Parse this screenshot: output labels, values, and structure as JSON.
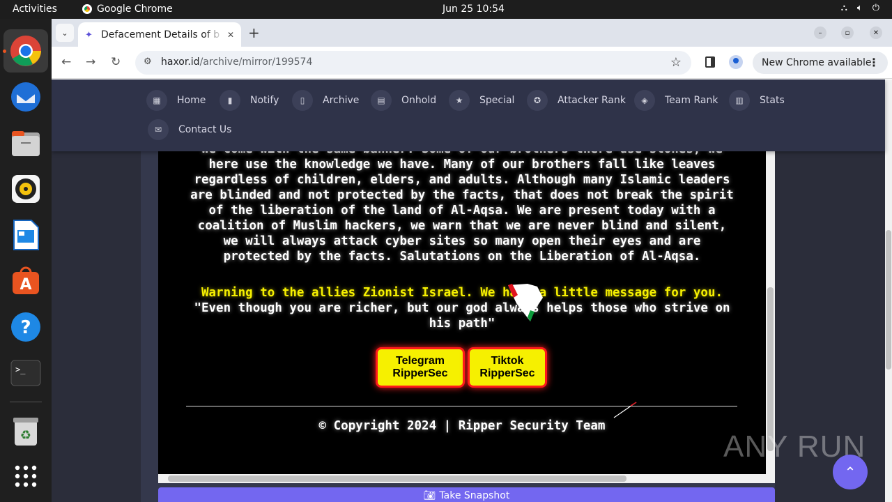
{
  "topbar": {
    "activities": "Activities",
    "app_name": "Google Chrome",
    "clock": "Jun 25  10:54"
  },
  "dock": {
    "items": [
      "chrome-icon",
      "thunderbird-icon",
      "files-icon",
      "rhythmbox-icon",
      "writer-icon",
      "app-center-icon",
      "help-icon",
      "terminal-icon",
      "trash-icon",
      "app-grid-icon"
    ]
  },
  "browser": {
    "tab_title": "Defacement Details of b",
    "url_host": "haxor.id",
    "url_path": "/archive/mirror/199574",
    "update_label": "New Chrome available"
  },
  "site_nav": {
    "items": [
      "Home",
      "Notify",
      "Archive",
      "Onhold",
      "Special",
      "Attacker Rank",
      "Team Rank",
      "Stats",
      "Contact Us"
    ]
  },
  "mirror": {
    "lines": [
      "we come with the same banner. Some of our brothers there use stones, we",
      "here use the knowledge we have. Many of our brothers fall like leaves",
      "regardless of children, elders, and adults. Although many Islamic leaders",
      "are blinded and not protected by the facts, that does not break the spirit",
      "of the liberation of the land of Al-Aqsa. We are present today with a",
      "coalition of Muslim hackers, we warn that we are never blind and silent,",
      "we will always attack cyber sites so many open their eyes and are",
      "protected by the facts. Salutations on the Liberation of Al-Aqsa."
    ],
    "warning_line": "Warning to the allies Zionist Israel. We have a little message for you.",
    "quote_lines": [
      "\"Even though you are richer, but our god always helps those who strive on",
      "his path\""
    ],
    "telegram_button": [
      "Telegram",
      "RipperSec"
    ],
    "tiktok_button": [
      "Tiktok",
      "RipperSec"
    ],
    "copyright": "© Copyright 2024 | Ripper Security Team"
  },
  "snapshot_button": "Take Snapshot",
  "watermark": "ANY RUN",
  "colors": {
    "accent": "#7367f0",
    "nav_bg": "#2f3349",
    "warning_yellow": "#f6f000",
    "button_border": "#ff1a1a"
  }
}
